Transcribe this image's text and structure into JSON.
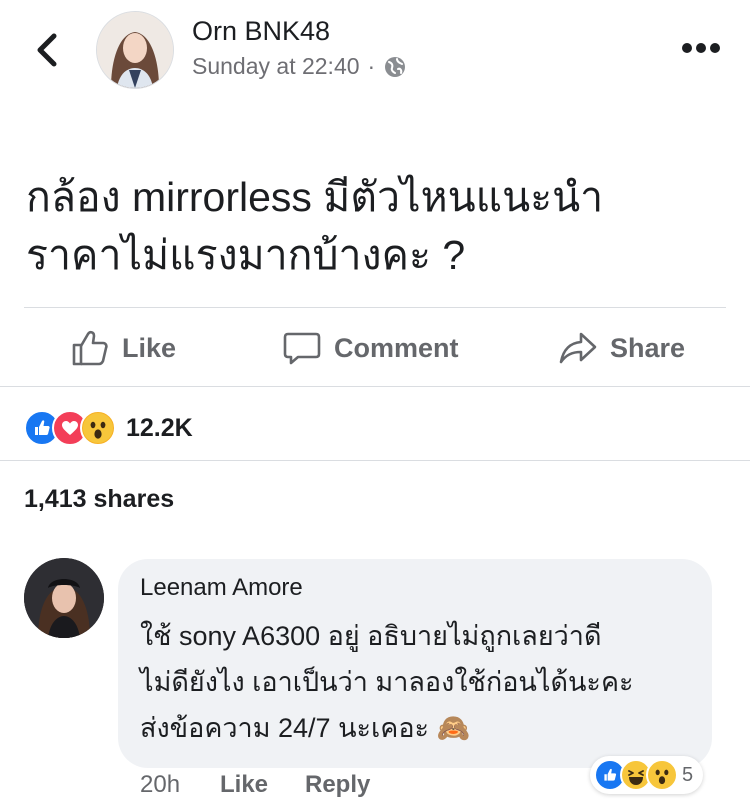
{
  "post": {
    "author": "Orn BNK48",
    "time": "Sunday at 22:40",
    "separator": "·",
    "text_lines": [
      "กล้อง mirrorless มีตัวไหนแนะนำ",
      "ราคาไม่แรงมากบ้างคะ ?"
    ]
  },
  "actions": {
    "like": "Like",
    "comment": "Comment",
    "share": "Share"
  },
  "reactions": {
    "count": "12.2K",
    "types": [
      "like-icon",
      "love-icon",
      "wow-icon"
    ]
  },
  "shares": "1,413 shares",
  "comment": {
    "author": "Leenam Amore",
    "text_lines": [
      "ใช้ sony A6300 อยู่ อธิบายไม่ถูกเลยว่าดี",
      "ไม่ดียังไง เอาเป็นว่า มาลองใช้ก่อนได้นะคะ",
      "ส่งข้อความ 24/7 นะเคอะ"
    ],
    "emoji": "🙈",
    "time": "20h",
    "like": "Like",
    "reply": "Reply",
    "reaction_count": "5",
    "reaction_types": [
      "like-icon",
      "haha-icon",
      "wow-icon"
    ]
  },
  "colors": {
    "like_blue": "#1877f2",
    "love_red": "#f33e58",
    "wow_yellow": "#f7b125",
    "text": "#1c1e21",
    "secondary": "#65676b",
    "bubble": "#f0f2f5"
  }
}
